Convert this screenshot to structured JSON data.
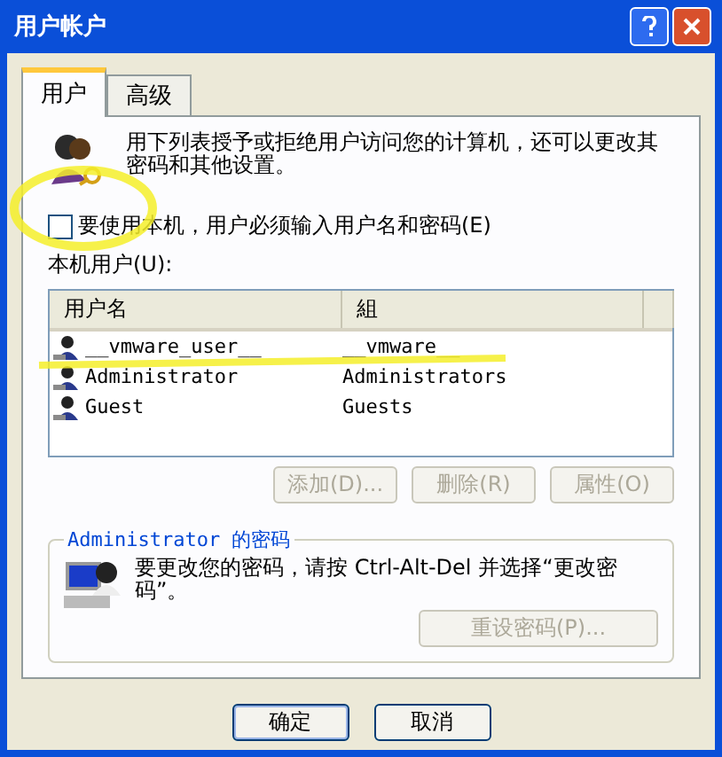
{
  "window": {
    "title": "用户帐户"
  },
  "tabs": [
    {
      "label": "用户",
      "selected": true
    },
    {
      "label": "高级",
      "selected": false
    }
  ],
  "intro": "用下列表授予或拒绝用户访问您的计算机，还可以更改其密码和其他设置。",
  "require_login": {
    "label": "要使用本机，用户必须输入用户名和密码(E)",
    "checked": false
  },
  "users_label": "本机用户(U):",
  "table": {
    "columns": [
      "用户名",
      "組"
    ],
    "rows": [
      {
        "cells": [
          "__vmware_user__",
          "__vmware__"
        ],
        "selected": false
      },
      {
        "cells": [
          "Administrator",
          "Administrators"
        ],
        "selected": false
      },
      {
        "cells": [
          "Guest",
          "Guests"
        ],
        "selected": false
      }
    ]
  },
  "user_buttons": [
    {
      "label": "添加(D)...",
      "disabled": true
    },
    {
      "label": "删除(R)",
      "disabled": true
    },
    {
      "label": "属性(O)",
      "disabled": true
    }
  ],
  "password_group": {
    "title": "Administrator 的密码",
    "text": "要更改您的密码，请按 Ctrl-Alt-Del 并选择“更改密码”。",
    "button": {
      "label": "重设密码(P)...",
      "disabled": true
    }
  },
  "buttons": [
    {
      "label": "确定",
      "default": true
    },
    {
      "label": "取消",
      "default": false
    }
  ],
  "annotations": [
    {
      "kind": "circle"
    },
    {
      "kind": "underline"
    }
  ]
}
